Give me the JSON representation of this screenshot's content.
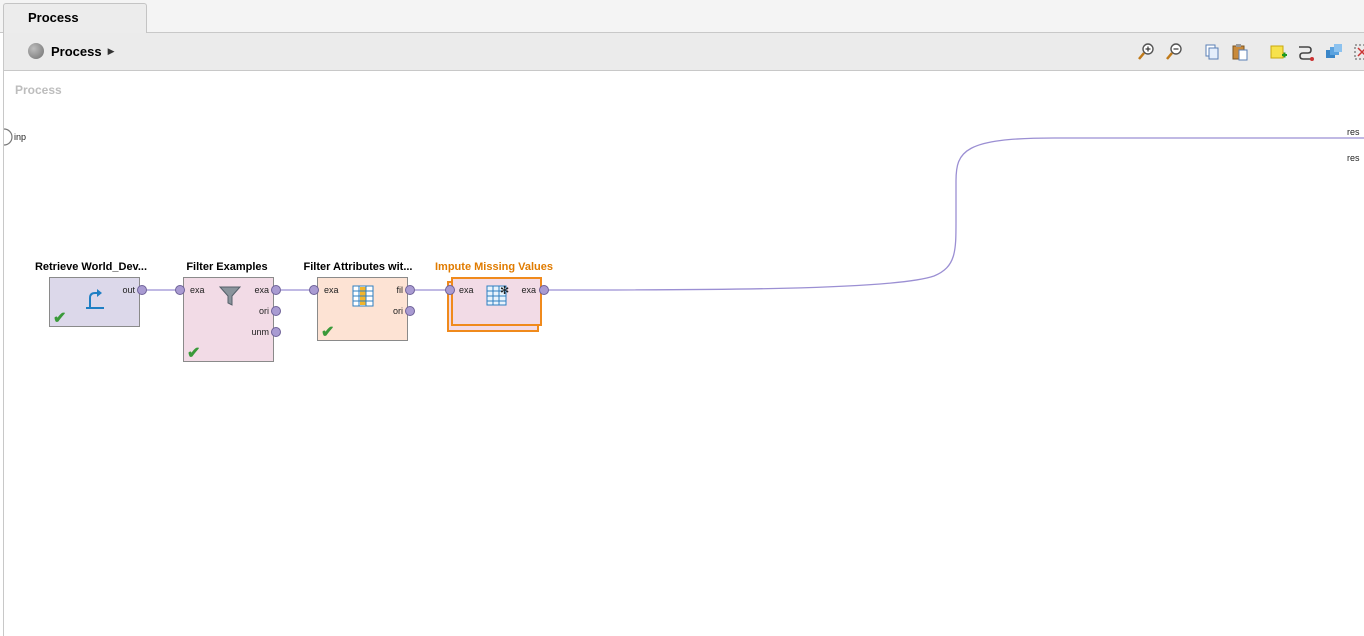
{
  "tab": {
    "label": "Process"
  },
  "breadcrumb": {
    "label": "Process"
  },
  "canvas": {
    "title": "Process"
  },
  "process_ports": {
    "input": "inp",
    "result1": "res",
    "result2": "res"
  },
  "operators": {
    "retrieve": {
      "title": "Retrieve World_Dev...",
      "out": "out"
    },
    "filter_examples": {
      "title": "Filter Examples",
      "in": "exa",
      "out1": "exa",
      "out2": "ori",
      "out3": "unm"
    },
    "filter_attributes": {
      "title": "Filter Attributes wit...",
      "in": "exa",
      "out1": "fil",
      "out2": "ori"
    },
    "impute": {
      "title": "Impute Missing Values",
      "in": "exa",
      "out": "exa"
    }
  },
  "colors": {
    "selected_title": "#e07b00",
    "selected_border": "#f08a1c",
    "retrieve_bg": "#dcd8ea",
    "filter_examples_bg": "#f2dbe6",
    "filter_attributes_bg": "#fde3d4",
    "impute_bg": "#f2dbe6",
    "wire": "#9b8fd3"
  },
  "icons": {
    "toolbar": [
      "zoom-in-icon",
      "zoom-out-icon",
      "copy-icon",
      "paste-icon",
      "add-note-icon",
      "auto-wire-icon",
      "arrange-icon",
      "fit-icon"
    ]
  }
}
